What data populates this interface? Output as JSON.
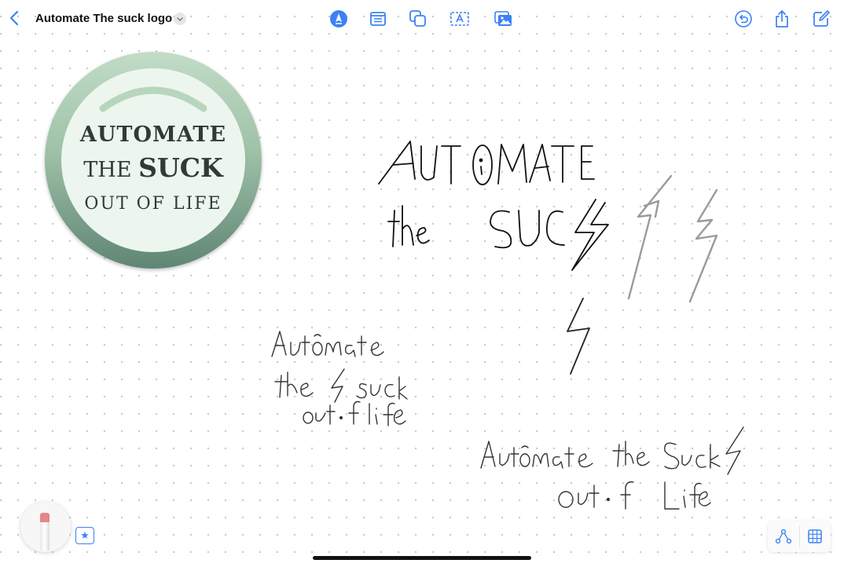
{
  "header": {
    "back_icon": "chevron-left-icon",
    "title": "Automate The suck logo",
    "title_menu_icon": "chevron-down-icon",
    "tools": [
      "pen-tool-icon",
      "note-icon",
      "shapes-icon",
      "text-box-icon",
      "media-icon"
    ],
    "actions": [
      "undo-icon",
      "share-icon",
      "compose-icon"
    ]
  },
  "logo": {
    "line1": "AUTOMATE",
    "line2_prefix": "THE ",
    "line2_bold": "SUCK",
    "line3": "OUT OF LIFE"
  },
  "colors": {
    "accent": "#3b82f6",
    "logo_ring_top": "#c2dcc7",
    "logo_ring_bottom": "#5f8574",
    "logo_fill": "#ecf6ee",
    "logo_text": "#2f3b36"
  },
  "footer": {
    "pencil_icon": "pencil-icon",
    "favorites_icon": "star-icon",
    "connections_icon": "connections-icon",
    "grid_icon": "grid-icon"
  }
}
